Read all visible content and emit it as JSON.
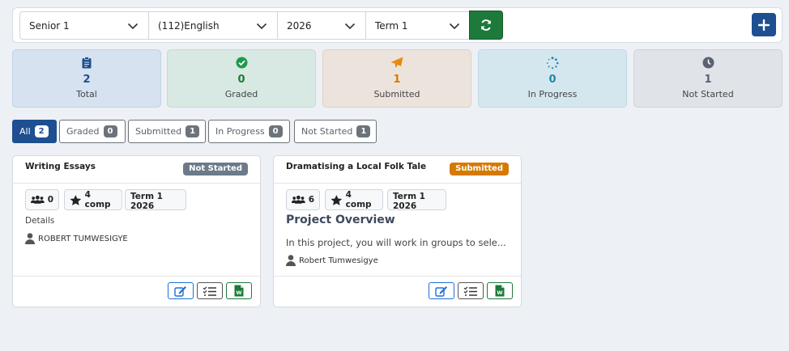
{
  "filters": {
    "class": "Senior 1",
    "subject": "(112)English",
    "year": "2026",
    "term": "Term 1",
    "refresh_icon": "refresh-icon",
    "add_icon": "plus-icon"
  },
  "stats": [
    {
      "key": "total",
      "value": "2",
      "label": "Total",
      "icon": "clipboard-icon",
      "color": "#1d4f91"
    },
    {
      "key": "graded",
      "value": "0",
      "label": "Graded",
      "icon": "check-circle-icon",
      "color": "#1d7a3a"
    },
    {
      "key": "submitted",
      "value": "1",
      "label": "Submitted",
      "icon": "paper-plane-icon",
      "color": "#d57a00"
    },
    {
      "key": "in_progress",
      "value": "0",
      "label": "In Progress",
      "icon": "spinner-icon",
      "color": "#1f8aa6"
    },
    {
      "key": "not_started",
      "value": "1",
      "label": "Not Started",
      "icon": "clock-icon",
      "color": "#5a6270"
    }
  ],
  "tabs": [
    {
      "label": "All",
      "count": "2",
      "active": true
    },
    {
      "label": "Graded",
      "count": "0"
    },
    {
      "label": "Submitted",
      "count": "1"
    },
    {
      "label": "In Progress",
      "count": "0"
    },
    {
      "label": "Not Started",
      "count": "1"
    }
  ],
  "assignments": [
    {
      "title": "Writing Essays",
      "status": "Not Started",
      "groups": "0",
      "competencies": "4 comp",
      "term": "Term 1 2026",
      "section_label": "Details",
      "author": "ROBERT TUMWESIGYE"
    },
    {
      "title": "Dramatising a Local Folk Tale",
      "status": "Submitted",
      "groups": "6",
      "competencies": "4 comp",
      "term": "Term 1 2026",
      "section_label": "Project Overview",
      "description": "In this project, you will work in groups to sele...",
      "author": "Robert Tumwesigye"
    }
  ]
}
